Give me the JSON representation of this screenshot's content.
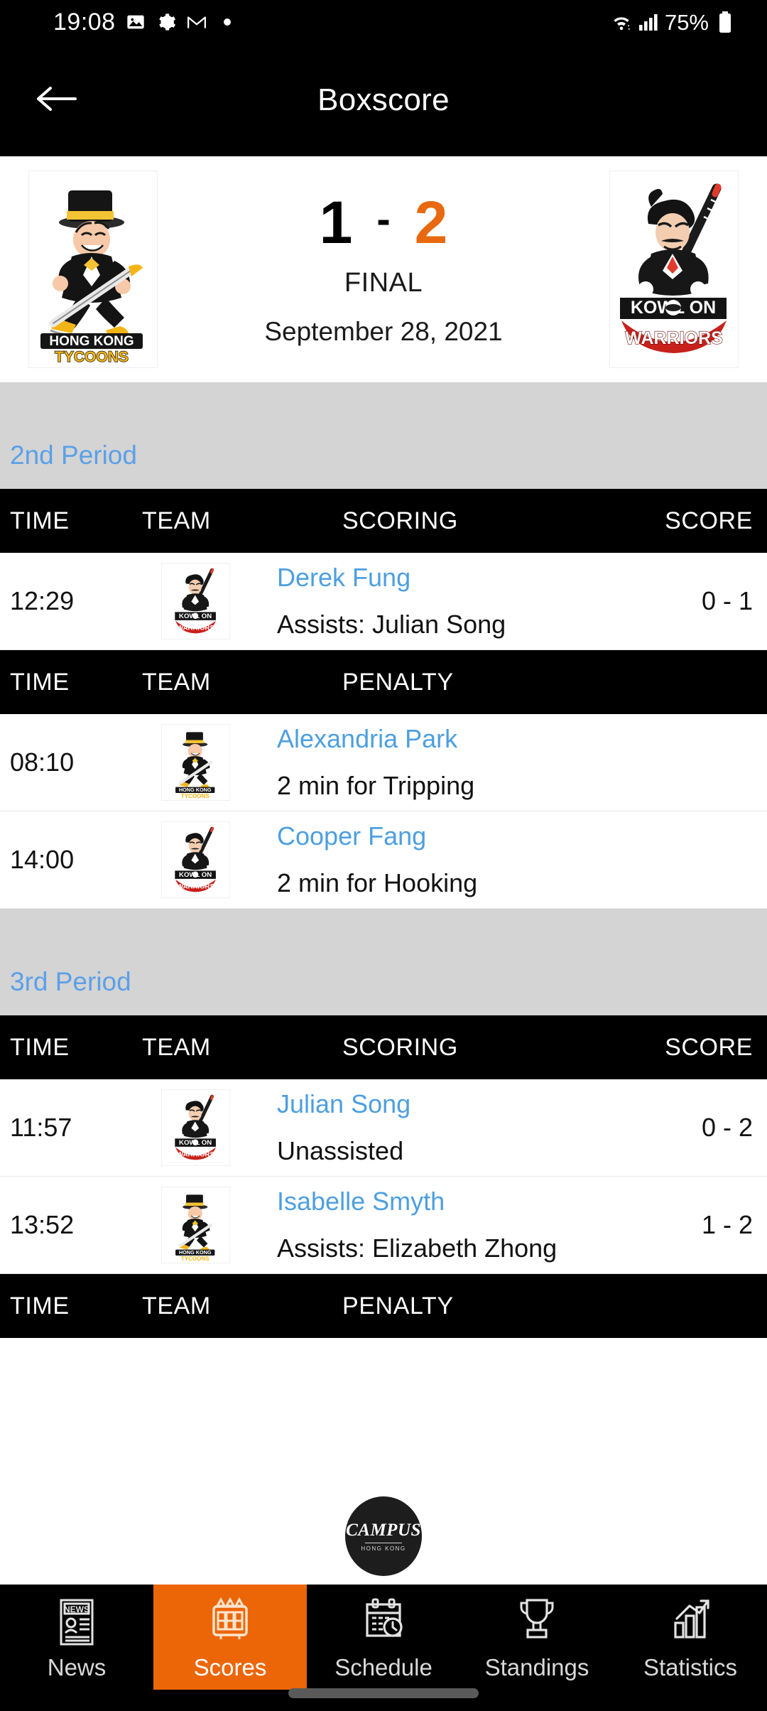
{
  "status_bar": {
    "time": "19:08",
    "battery_percent": "75%",
    "left_icons": [
      "image-icon",
      "gear-icon",
      "gmail-icon",
      "dot-icon"
    ],
    "right_icons": [
      "wifi-icon",
      "cellular-signal-icon",
      "battery-icon"
    ]
  },
  "header": {
    "title": "Boxscore",
    "back_icon": "back-arrow-icon"
  },
  "scoreboard": {
    "home_team": "HONG KONG TYCOONS",
    "away_team": "KOWLOON WARRIORS",
    "home_score": "1",
    "separator": "-",
    "away_score": "2",
    "status": "FINAL",
    "date": "September 28, 2021",
    "away_score_color": "#e8690f"
  },
  "periods": [
    {
      "label": "2nd Period",
      "sections": [
        {
          "kind": "scoring",
          "headers": {
            "time": "TIME",
            "team": "TEAM",
            "middle": "SCORING",
            "score": "SCORE"
          },
          "rows": [
            {
              "time": "12:29",
              "team_logo": "kowloon-warriors-logo",
              "player": "Derek Fung",
              "detail": "Assists: Julian Song",
              "score": "0 - 1"
            }
          ]
        },
        {
          "kind": "penalty",
          "headers": {
            "time": "TIME",
            "team": "TEAM",
            "middle": "PENALTY",
            "score": ""
          },
          "rows": [
            {
              "time": "08:10",
              "team_logo": "hong-kong-tycoons-logo",
              "player": "Alexandria Park",
              "detail": "2 min for Tripping",
              "score": ""
            },
            {
              "time": "14:00",
              "team_logo": "kowloon-warriors-logo",
              "player": "Cooper Fang",
              "detail": "2 min for Hooking",
              "score": ""
            }
          ]
        }
      ]
    },
    {
      "label": "3rd Period",
      "sections": [
        {
          "kind": "scoring",
          "headers": {
            "time": "TIME",
            "team": "TEAM",
            "middle": "SCORING",
            "score": "SCORE"
          },
          "rows": [
            {
              "time": "11:57",
              "team_logo": "kowloon-warriors-logo",
              "player": "Julian Song",
              "detail": "Unassisted",
              "score": "0 - 2"
            },
            {
              "time": "13:52",
              "team_logo": "hong-kong-tycoons-logo",
              "player": "Isabelle Smyth",
              "detail": "Assists: Elizabeth Zhong",
              "score": "1 - 2"
            }
          ]
        },
        {
          "kind": "penalty",
          "headers": {
            "time": "TIME",
            "team": "TEAM",
            "middle": "PENALTY",
            "score": ""
          },
          "rows": []
        }
      ]
    }
  ],
  "campus_logo": {
    "word": "CAMPUS",
    "sub": "HONG KONG"
  },
  "bottom_nav": {
    "active_color": "#ec6608",
    "items": [
      {
        "label": "News",
        "icon": "newspaper-icon",
        "active": false
      },
      {
        "label": "Scores",
        "icon": "scoreboard-icon",
        "active": true
      },
      {
        "label": "Schedule",
        "icon": "calendar-clock-icon",
        "active": false
      },
      {
        "label": "Standings",
        "icon": "trophy-icon",
        "active": false
      },
      {
        "label": "Statistics",
        "icon": "bar-chart-icon",
        "active": false
      }
    ]
  }
}
